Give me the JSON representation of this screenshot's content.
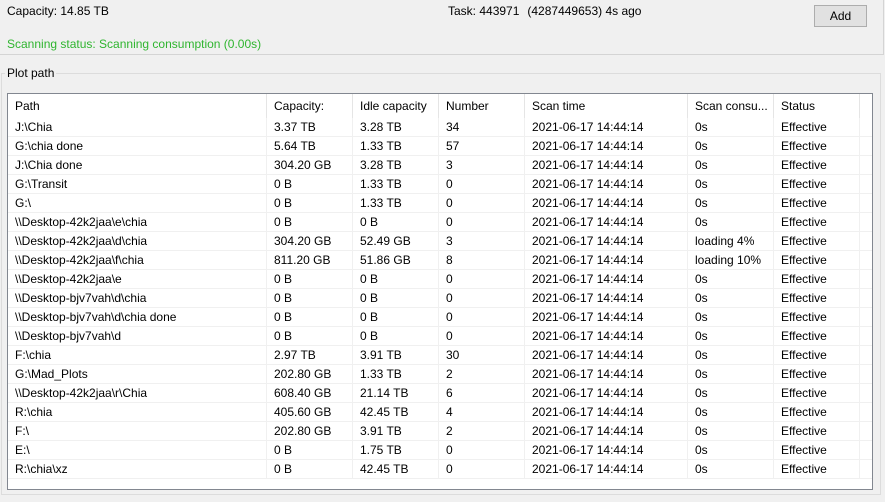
{
  "info": {
    "capacity": "Capacity: 14.85 TB",
    "task_label": "Task: 443971",
    "task_extra": "(4287449653) 4s ago",
    "scanning_status": "Scanning status: Scanning consumption (0.00s)"
  },
  "buttons": {
    "add": "Add"
  },
  "plot_path": {
    "label": "Plot path",
    "columns": [
      "Path",
      "Capacity:",
      "Idle capacity",
      "Number",
      "Scan time",
      "Scan consu...",
      "Status"
    ],
    "rows": [
      [
        "J:\\Chia",
        "3.37 TB",
        "3.28 TB",
        "34",
        "2021-06-17 14:44:14",
        "0s",
        "Effective"
      ],
      [
        "G:\\chia done",
        "5.64 TB",
        "1.33 TB",
        "57",
        "2021-06-17 14:44:14",
        "0s",
        "Effective"
      ],
      [
        "J:\\Chia done",
        "304.20 GB",
        "3.28 TB",
        "3",
        "2021-06-17 14:44:14",
        "0s",
        "Effective"
      ],
      [
        "G:\\Transit",
        "0 B",
        "1.33 TB",
        "0",
        "2021-06-17 14:44:14",
        "0s",
        "Effective"
      ],
      [
        "G:\\",
        "0 B",
        "1.33 TB",
        "0",
        "2021-06-17 14:44:14",
        "0s",
        "Effective"
      ],
      [
        "\\\\Desktop-42k2jaa\\e\\chia",
        "0 B",
        "0 B",
        "0",
        "2021-06-17 14:44:14",
        "0s",
        "Effective"
      ],
      [
        "\\\\Desktop-42k2jaa\\d\\chia",
        "304.20 GB",
        "52.49 GB",
        "3",
        "2021-06-17 14:44:14",
        "loading 4%",
        "Effective"
      ],
      [
        "\\\\Desktop-42k2jaa\\f\\chia",
        "811.20 GB",
        "51.86 GB",
        "8",
        "2021-06-17 14:44:14",
        "loading 10%",
        "Effective"
      ],
      [
        "\\\\Desktop-42k2jaa\\e",
        "0 B",
        "0 B",
        "0",
        "2021-06-17 14:44:14",
        "0s",
        "Effective"
      ],
      [
        "\\\\Desktop-bjv7vah\\d\\chia",
        "0 B",
        "0 B",
        "0",
        "2021-06-17 14:44:14",
        "0s",
        "Effective"
      ],
      [
        "\\\\Desktop-bjv7vah\\d\\chia done",
        "0 B",
        "0 B",
        "0",
        "2021-06-17 14:44:14",
        "0s",
        "Effective"
      ],
      [
        "\\\\Desktop-bjv7vah\\d",
        "0 B",
        "0 B",
        "0",
        "2021-06-17 14:44:14",
        "0s",
        "Effective"
      ],
      [
        "F:\\chia",
        "2.97 TB",
        "3.91 TB",
        "30",
        "2021-06-17 14:44:14",
        "0s",
        "Effective"
      ],
      [
        "G:\\Mad_Plots",
        "202.80 GB",
        "1.33 TB",
        "2",
        "2021-06-17 14:44:14",
        "0s",
        "Effective"
      ],
      [
        "\\\\Desktop-42k2jaa\\r\\Chia",
        "608.40 GB",
        "21.14 TB",
        "6",
        "2021-06-17 14:44:14",
        "0s",
        "Effective"
      ],
      [
        "R:\\chia",
        "405.60 GB",
        "42.45 TB",
        "4",
        "2021-06-17 14:44:14",
        "0s",
        "Effective"
      ],
      [
        "F:\\",
        "202.80 GB",
        "3.91 TB",
        "2",
        "2021-06-17 14:44:14",
        "0s",
        "Effective"
      ],
      [
        "E:\\",
        "0 B",
        "1.75 TB",
        "0",
        "2021-06-17 14:44:14",
        "0s",
        "Effective"
      ],
      [
        "R:\\chia\\xz",
        "0 B",
        "42.45 TB",
        "0",
        "2021-06-17 14:44:14",
        "0s",
        "Effective"
      ]
    ]
  },
  "colors": {
    "status_green": "#2fb52f",
    "window_bg": "#f0f0f0",
    "list_bg": "#ffffff"
  }
}
